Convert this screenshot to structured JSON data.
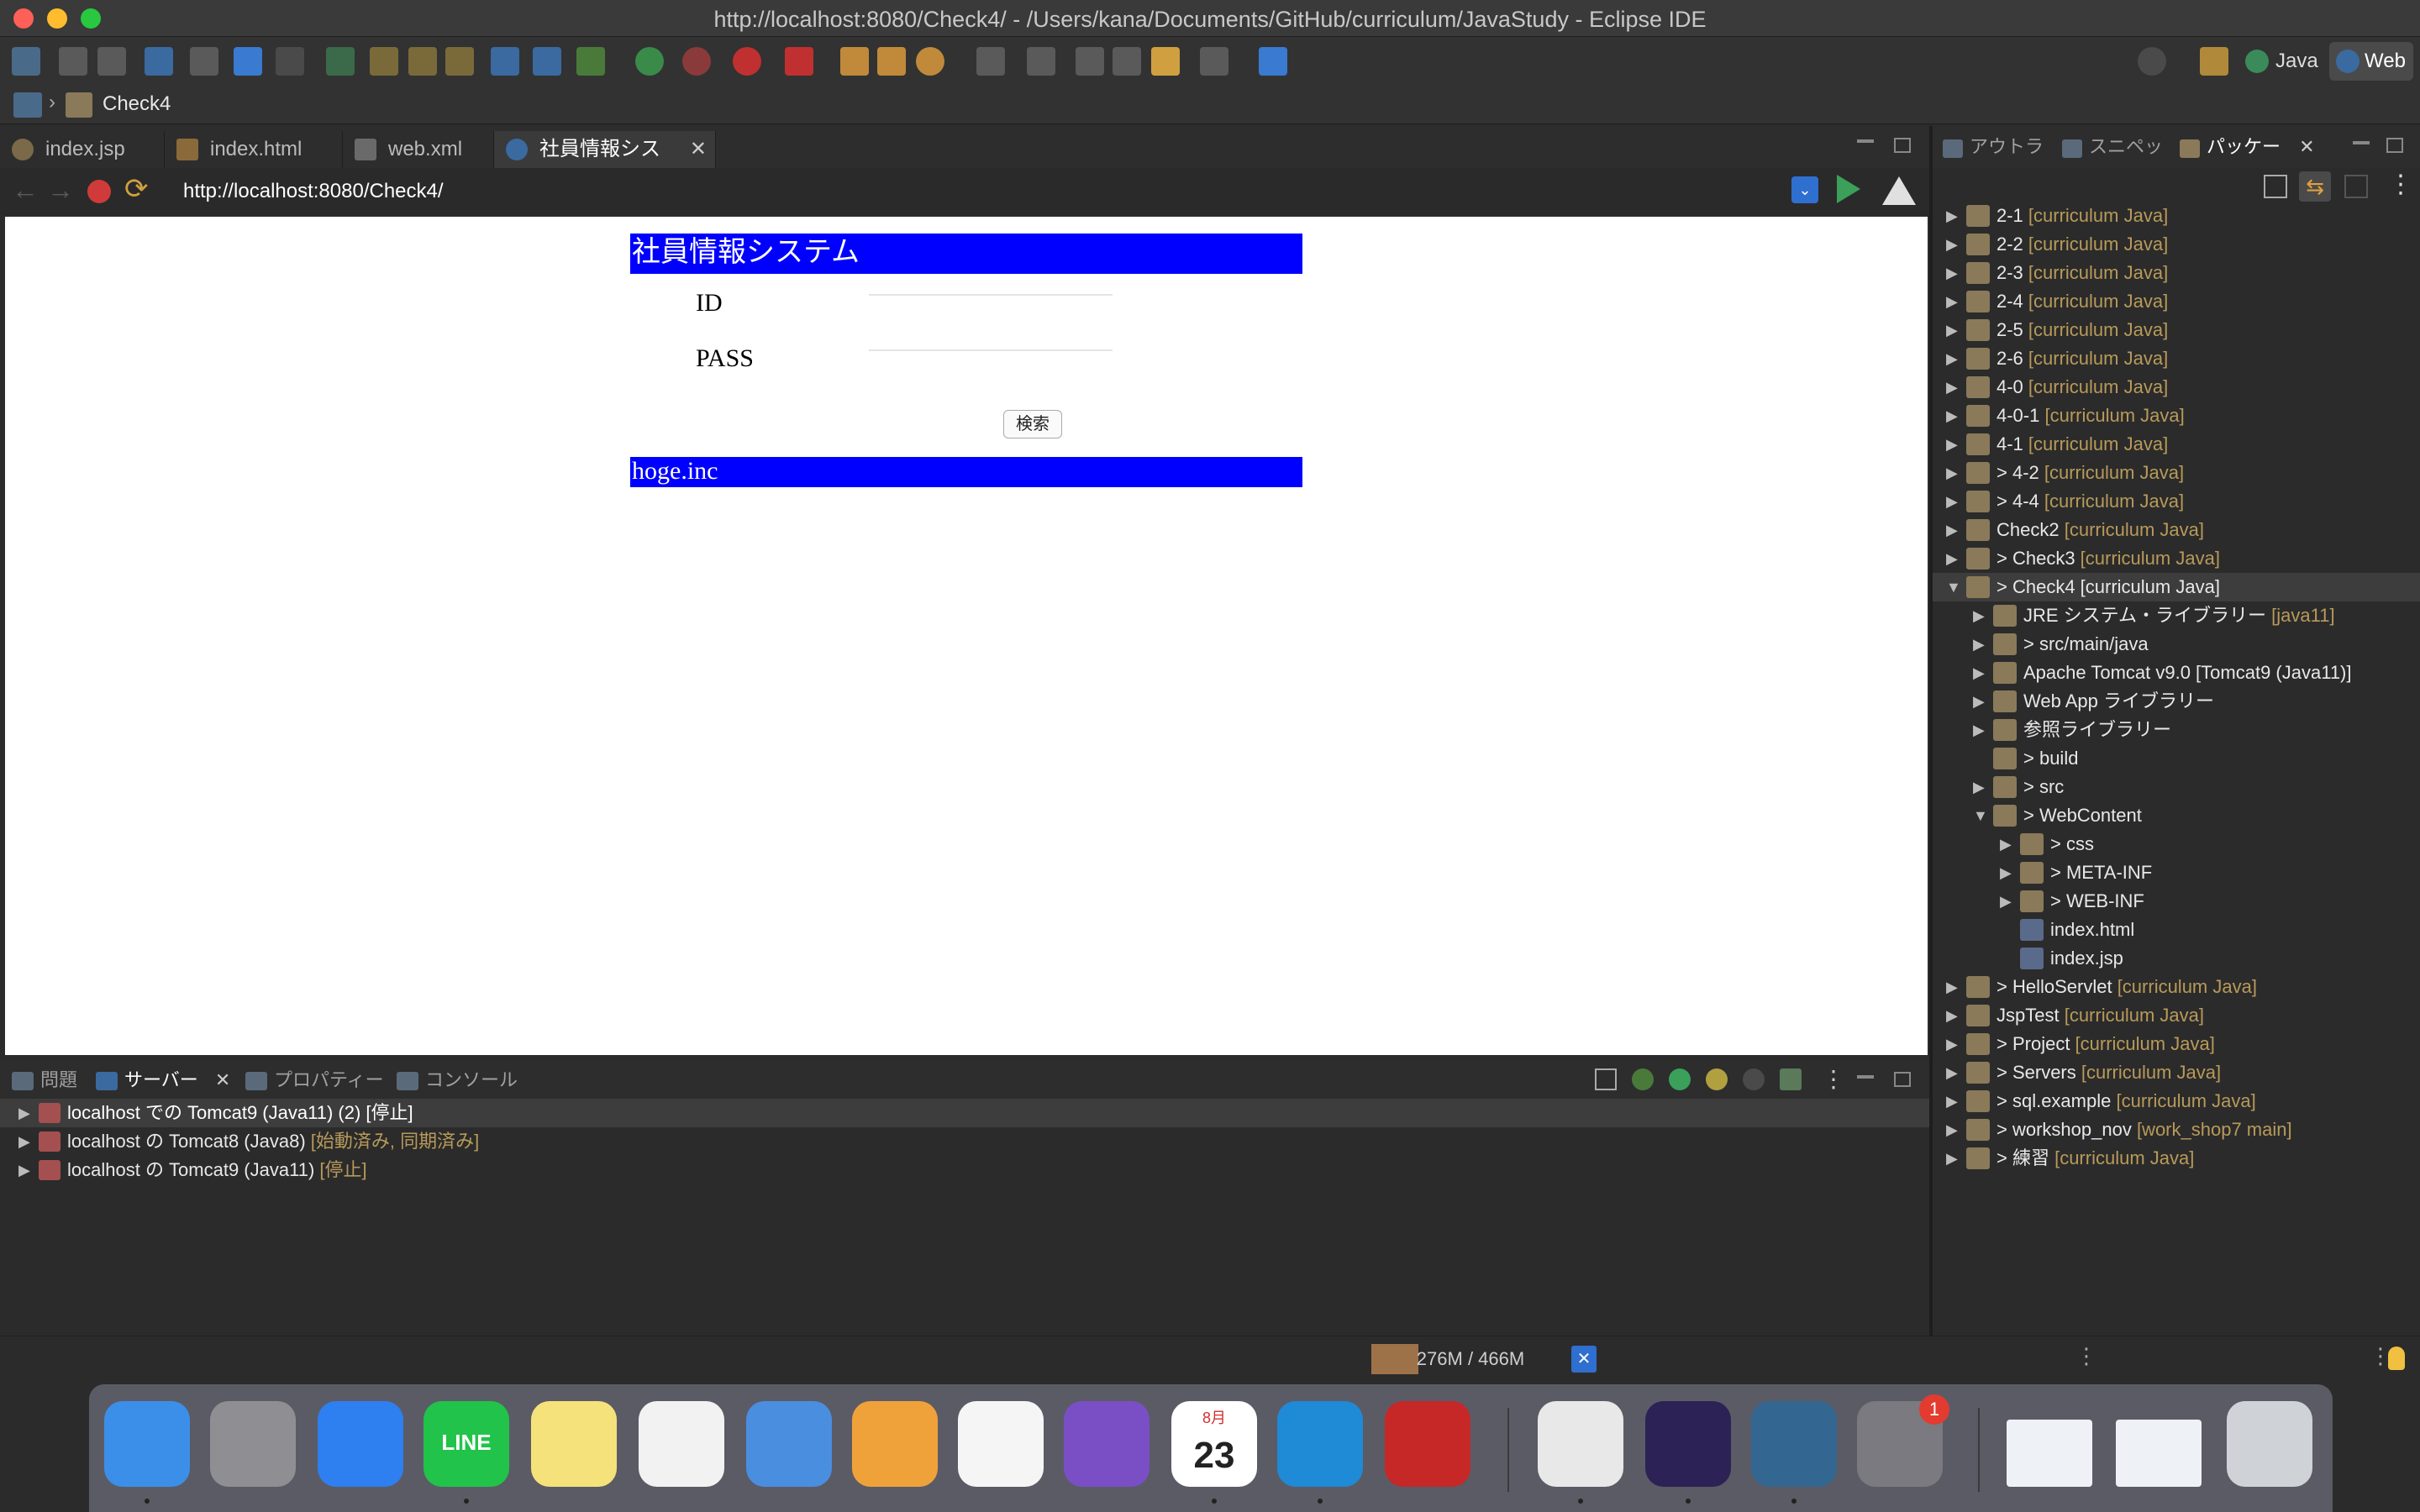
{
  "window": {
    "title": "http://localhost:8080/Check4/ - /Users/kana/Documents/GitHub/curriculum/JavaStudy - Eclipse IDE"
  },
  "toolbar": {
    "perspectives": [
      "Java",
      "Web"
    ]
  },
  "breadcrumb": {
    "project": "Check4"
  },
  "editor_tabs": [
    {
      "label": "index.jsp"
    },
    {
      "label": "index.html"
    },
    {
      "label": "web.xml"
    },
    {
      "label": "社員情報システム",
      "active": true
    }
  ],
  "browser": {
    "url": "http://localhost:8080/Check4/",
    "page": {
      "header": "社員情報システム",
      "id_label": "ID",
      "pass_label": "PASS",
      "id_value": "",
      "pass_value": "",
      "search_button": "検索",
      "footer": "hoge.inc"
    }
  },
  "bottom_panel": {
    "tabs": [
      {
        "label": "問題"
      },
      {
        "label": "サーバー",
        "active": true
      },
      {
        "label": "プロパティー"
      },
      {
        "label": "コンソール"
      }
    ],
    "servers": [
      {
        "name": "localhost での Tomcat9 (Java11) (2)",
        "state": "[停止]"
      },
      {
        "name": "localhost の Tomcat8 (Java8)",
        "state": "[始動済み, 同期済み]"
      },
      {
        "name": "localhost の Tomcat9 (Java11)",
        "state": "[停止]"
      }
    ]
  },
  "status": {
    "memory": "276M / 466M",
    "memory_used_fraction": 0.59
  },
  "right_panel": {
    "tabs": [
      {
        "label": "アウトラ"
      },
      {
        "label": "スニペッ"
      },
      {
        "label": "パッケー",
        "active": true
      }
    ],
    "tree": [
      {
        "label": "2-1",
        "dec": "[curriculum Java]",
        "level": 0,
        "state": "closed"
      },
      {
        "label": "2-2",
        "dec": "[curriculum Java]",
        "level": 0,
        "state": "closed"
      },
      {
        "label": "2-3",
        "dec": "[curriculum Java]",
        "level": 0,
        "state": "closed"
      },
      {
        "label": "2-4",
        "dec": "[curriculum Java]",
        "level": 0,
        "state": "closed"
      },
      {
        "label": "2-5",
        "dec": "[curriculum Java]",
        "level": 0,
        "state": "closed"
      },
      {
        "label": "2-6",
        "dec": "[curriculum Java]",
        "level": 0,
        "state": "closed"
      },
      {
        "label": "4-0",
        "dec": "[curriculum Java]",
        "level": 0,
        "state": "closed"
      },
      {
        "label": "4-0-1",
        "dec": "[curriculum Java]",
        "level": 0,
        "state": "closed"
      },
      {
        "label": "4-1",
        "dec": "[curriculum Java]",
        "level": 0,
        "state": "closed"
      },
      {
        "label": "> 4-2",
        "dec": "[curriculum Java]",
        "level": 0,
        "state": "closed"
      },
      {
        "label": "> 4-4",
        "dec": "[curriculum Java]",
        "level": 0,
        "state": "closed"
      },
      {
        "label": "Check2",
        "dec": "[curriculum Java]",
        "level": 0,
        "state": "closed"
      },
      {
        "label": "> Check3",
        "dec": "[curriculum Java]",
        "level": 0,
        "state": "closed"
      },
      {
        "label": "> Check4 [curriculum Java]",
        "dec": "",
        "level": 0,
        "state": "open",
        "selected": true
      },
      {
        "label": "JRE システム・ライブラリー",
        "dec": "[java11]",
        "level": 1,
        "state": "closed"
      },
      {
        "label": "> src/main/java",
        "dec": "",
        "level": 1,
        "state": "closed"
      },
      {
        "label": "Apache Tomcat v9.0 [Tomcat9 (Java11)]",
        "dec": "",
        "level": 1,
        "state": "closed"
      },
      {
        "label": "Web App ライブラリー",
        "dec": "",
        "level": 1,
        "state": "closed"
      },
      {
        "label": "参照ライブラリー",
        "dec": "",
        "level": 1,
        "state": "closed"
      },
      {
        "label": "> build",
        "dec": "",
        "level": 1,
        "state": "none"
      },
      {
        "label": "> src",
        "dec": "",
        "level": 1,
        "state": "closed"
      },
      {
        "label": "> WebContent",
        "dec": "",
        "level": 1,
        "state": "open"
      },
      {
        "label": "> css",
        "dec": "",
        "level": 2,
        "state": "closed"
      },
      {
        "label": "> META-INF",
        "dec": "",
        "level": 2,
        "state": "closed"
      },
      {
        "label": "> WEB-INF",
        "dec": "",
        "level": 2,
        "state": "closed"
      },
      {
        "label": "index.html",
        "dec": "",
        "level": 2,
        "state": "none"
      },
      {
        "label": "index.jsp",
        "dec": "",
        "level": 2,
        "state": "none"
      },
      {
        "label": "> HelloServlet",
        "dec": "[curriculum Java]",
        "level": 0,
        "state": "closed"
      },
      {
        "label": "JspTest",
        "dec": "[curriculum Java]",
        "level": 0,
        "state": "closed"
      },
      {
        "label": "> Project",
        "dec": "[curriculum Java]",
        "level": 0,
        "state": "closed"
      },
      {
        "label": "> Servers",
        "dec": "[curriculum Java]",
        "level": 0,
        "state": "closed"
      },
      {
        "label": "> sql.example",
        "dec": "[curriculum Java]",
        "level": 0,
        "state": "closed"
      },
      {
        "label": "> workshop_nov",
        "dec": "[work_shop7 main]",
        "level": 0,
        "state": "closed"
      },
      {
        "label": "> 練習",
        "dec": "[curriculum Java]",
        "level": 0,
        "state": "closed"
      }
    ]
  },
  "dock": {
    "apps": [
      {
        "name": "finder-icon",
        "color": "#3b8fe8"
      },
      {
        "name": "launchpad-icon",
        "color": "#8e8e93"
      },
      {
        "name": "safari-icon",
        "color": "#2e7ff0"
      },
      {
        "name": "line-icon",
        "color": "#22c34a",
        "label": "LINE"
      },
      {
        "name": "notes-icon",
        "color": "#f6e27a"
      },
      {
        "name": "numbers-icon",
        "color": "#f2f2f2"
      },
      {
        "name": "keynote-icon",
        "color": "#4a8ee0"
      },
      {
        "name": "pages-icon",
        "color": "#f0a23a"
      },
      {
        "name": "textedit-icon",
        "color": "#f5f5f5"
      },
      {
        "name": "github-desktop-icon",
        "color": "#7a4fc6"
      },
      {
        "name": "calendar-icon",
        "color": "#ffffff",
        "label": "23",
        "sublabel": "8月"
      },
      {
        "name": "vscode-icon",
        "color": "#1f8ad6"
      },
      {
        "name": "mcafee-icon",
        "color": "#c62828"
      },
      {
        "name": "chrome-icon",
        "color": "#e8e8e8"
      },
      {
        "name": "eclipse-icon",
        "color": "#2c2255"
      },
      {
        "name": "postgres-icon",
        "color": "#336791"
      },
      {
        "name": "system-preferences-icon",
        "color": "#7a7a80",
        "badge": "1"
      },
      {
        "name": "preview-window-1",
        "color": "#eef2f6"
      },
      {
        "name": "preview-window-2",
        "color": "#eef2f6"
      },
      {
        "name": "trash-icon",
        "color": "#cfd3d8"
      }
    ]
  }
}
